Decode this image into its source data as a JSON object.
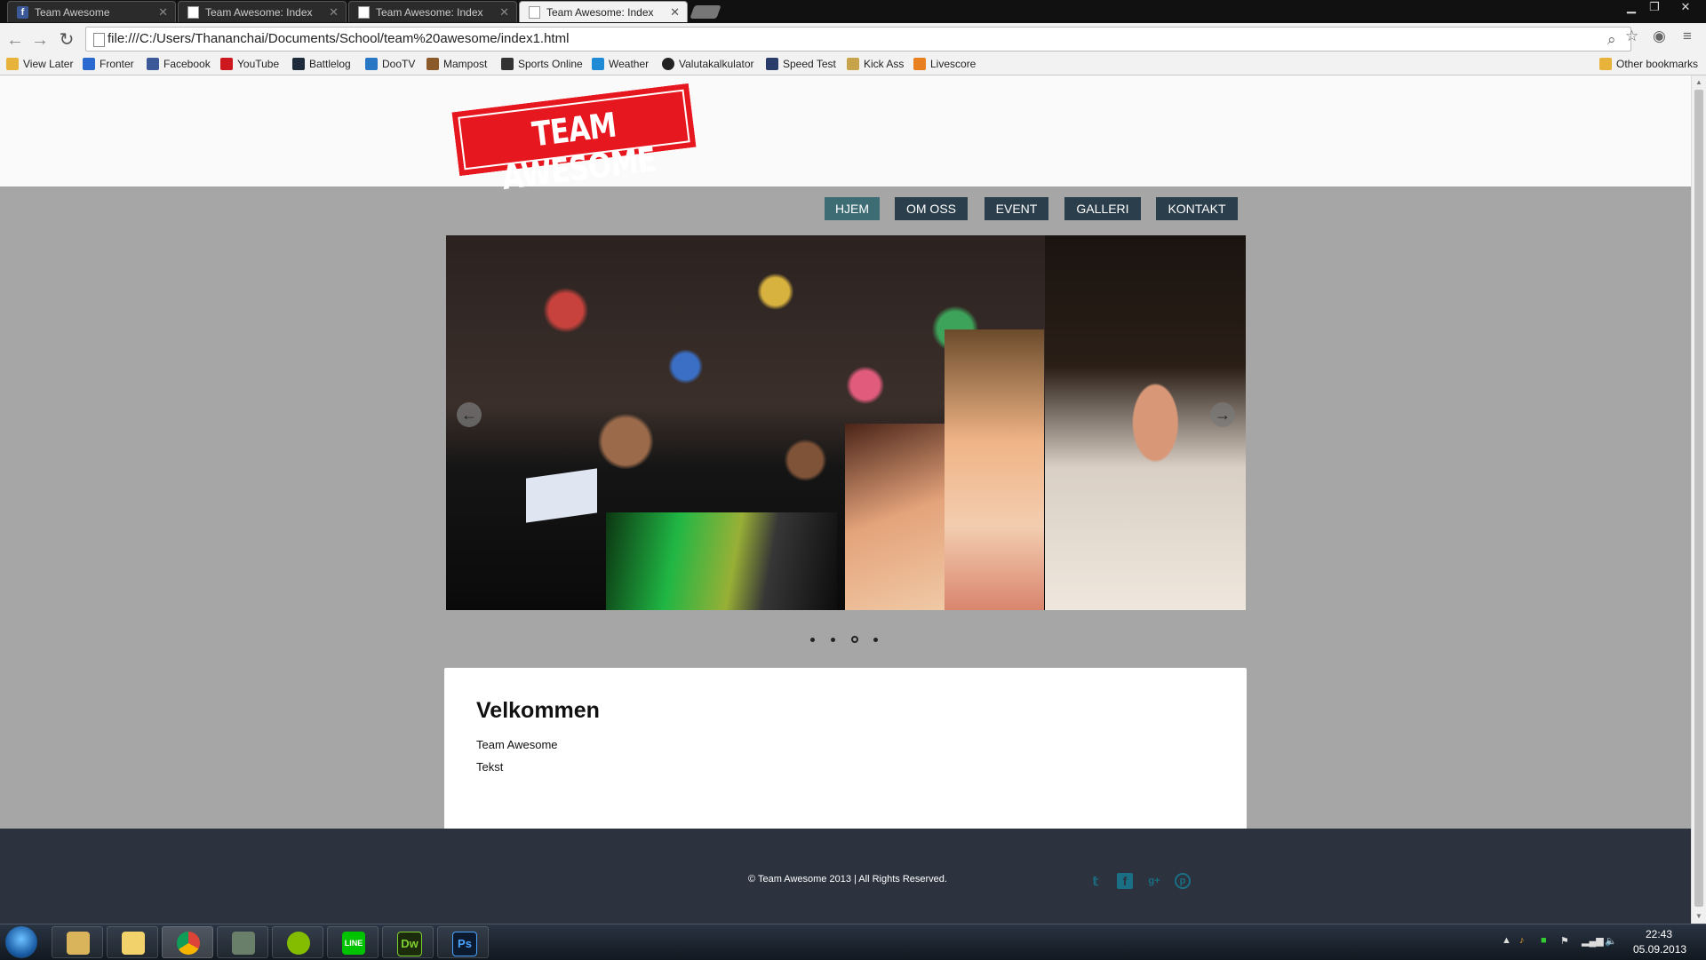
{
  "browser": {
    "tabs": [
      {
        "title": "Team Awesome",
        "icon": "facebook-icon"
      },
      {
        "title": "Team Awesome: Index",
        "icon": "document-icon"
      },
      {
        "title": "Team Awesome: Index",
        "icon": "document-icon"
      },
      {
        "title": "Team Awesome: Index",
        "icon": "document-icon",
        "active": true
      }
    ],
    "url": "file:///C:/Users/Thananchai/Documents/School/team%20awesome/index1.html",
    "bookmarks": [
      {
        "label": "View Later",
        "icon": "folder-icon",
        "color": "#e8b33a"
      },
      {
        "label": "Fronter",
        "icon": "fronter-icon",
        "color": "#2a6ad0"
      },
      {
        "label": "Facebook",
        "icon": "facebook-icon",
        "color": "#3b5998"
      },
      {
        "label": "YouTube",
        "icon": "youtube-icon",
        "color": "#cc181e"
      },
      {
        "label": "Battlelog",
        "icon": "battlelog-icon",
        "color": "#1d2b3a"
      },
      {
        "label": "DooTV",
        "icon": "dootv-icon",
        "color": "#2777c4"
      },
      {
        "label": "Mampost",
        "icon": "mampost-icon",
        "color": "#8a5a2b"
      },
      {
        "label": "Sports Online",
        "icon": "sports-icon",
        "color": "#333333"
      },
      {
        "label": "Weather",
        "icon": "yr-icon",
        "color": "#1f8ad6"
      },
      {
        "label": "Valutakalkulator",
        "icon": "valuta-icon",
        "color": "#222222"
      },
      {
        "label": "Speed Test",
        "icon": "speedtest-icon",
        "color": "#2a3d6a"
      },
      {
        "label": "Kick Ass",
        "icon": "kickass-icon",
        "color": "#c8a34a"
      },
      {
        "label": "Livescore",
        "icon": "livescore-icon",
        "color": "#e8801f"
      }
    ],
    "other_bookmarks": "Other bookmarks"
  },
  "site": {
    "logo_text": "TEAM AWESOME",
    "logo_color": "#e6171f",
    "nav": [
      {
        "label": "HJEM",
        "active": true
      },
      {
        "label": "OM OSS"
      },
      {
        "label": "EVENT"
      },
      {
        "label": "GALLERI"
      },
      {
        "label": "KONTAKT"
      }
    ],
    "slider": {
      "prev_icon": "arrow-left-icon",
      "next_icon": "arrow-right-icon",
      "dots": 4,
      "active_dot": 3
    },
    "content": {
      "title": "Velkommen",
      "line1": "Team Awesome",
      "line2": "Tekst"
    },
    "footer": {
      "copyright": "© Team Awesome 2013 | All Rights Reserved.",
      "social": [
        "twitter-icon",
        "facebook-icon",
        "google-plus-icon",
        "pinterest-icon"
      ]
    }
  },
  "taskbar": {
    "apps": [
      "explorer-icon",
      "folder-icon",
      "chrome-icon",
      "network-icon",
      "spotify-icon",
      "line-icon",
      "dreamweaver-icon",
      "photoshop-icon"
    ],
    "time": "22:43",
    "date": "05.09.2013"
  }
}
